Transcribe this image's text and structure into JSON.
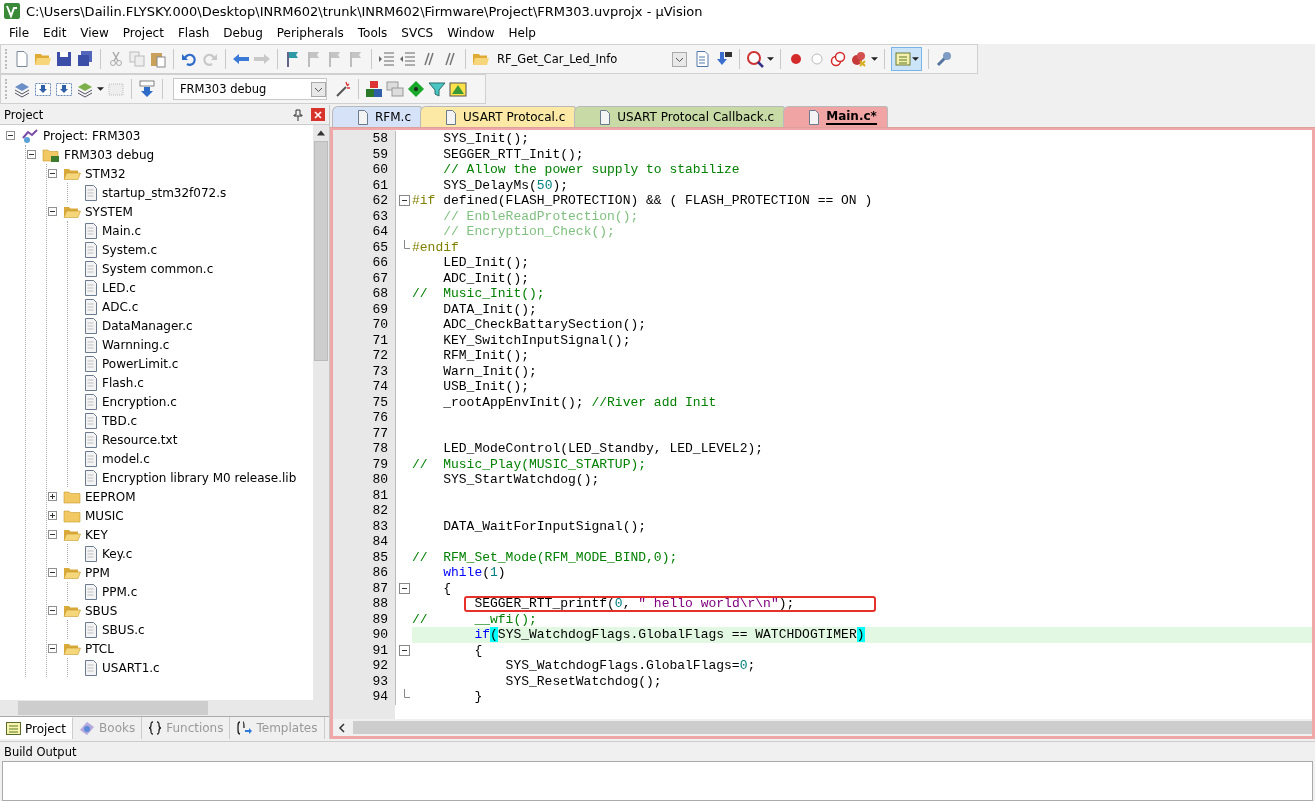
{
  "window": {
    "title": "C:\\Users\\Dailin.FLYSKY.000\\Desktop\\INRM602\\trunk\\INRM602\\Firmware\\Project\\FRM303.uvprojx - µVision"
  },
  "menu": [
    "File",
    "Edit",
    "View",
    "Project",
    "Flash",
    "Debug",
    "Peripherals",
    "Tools",
    "SVCS",
    "Window",
    "Help"
  ],
  "toolbar": {
    "find_combo": "RF_Get_Car_Led_Info",
    "target_combo": "FRM303 debug"
  },
  "project_panel": {
    "title": "Project",
    "tree": [
      {
        "label": "Project: FRM303",
        "kind": "project",
        "expanded": true,
        "children": [
          {
            "label": "FRM303 debug",
            "kind": "target",
            "expanded": true,
            "children": [
              {
                "label": "STM32",
                "kind": "folder",
                "expanded": true,
                "children": [
                  {
                    "label": "startup_stm32f072.s",
                    "kind": "file"
                  }
                ]
              },
              {
                "label": "SYSTEM",
                "kind": "folder",
                "expanded": true,
                "children": [
                  {
                    "label": "Main.c",
                    "kind": "file"
                  },
                  {
                    "label": "System.c",
                    "kind": "file"
                  },
                  {
                    "label": "System common.c",
                    "kind": "file"
                  },
                  {
                    "label": "LED.c",
                    "kind": "file"
                  },
                  {
                    "label": "ADC.c",
                    "kind": "file"
                  },
                  {
                    "label": "DataManager.c",
                    "kind": "file"
                  },
                  {
                    "label": "Warnning.c",
                    "kind": "file"
                  },
                  {
                    "label": "PowerLimit.c",
                    "kind": "file"
                  },
                  {
                    "label": "Flash.c",
                    "kind": "file"
                  },
                  {
                    "label": "Encryption.c",
                    "kind": "file"
                  },
                  {
                    "label": "TBD.c",
                    "kind": "file"
                  },
                  {
                    "label": "Resource.txt",
                    "kind": "file"
                  },
                  {
                    "label": "model.c",
                    "kind": "file"
                  },
                  {
                    "label": "Encryption library M0 release.lib",
                    "kind": "file"
                  }
                ]
              },
              {
                "label": "EEPROM",
                "kind": "folder",
                "expanded": false
              },
              {
                "label": "MUSIC",
                "kind": "folder",
                "expanded": false
              },
              {
                "label": "KEY",
                "kind": "folder",
                "expanded": true,
                "children": [
                  {
                    "label": "Key.c",
                    "kind": "file"
                  }
                ]
              },
              {
                "label": "PPM",
                "kind": "folder",
                "expanded": true,
                "children": [
                  {
                    "label": "PPM.c",
                    "kind": "file"
                  }
                ]
              },
              {
                "label": "SBUS",
                "kind": "folder",
                "expanded": true,
                "children": [
                  {
                    "label": "SBUS.c",
                    "kind": "file"
                  }
                ]
              },
              {
                "label": "PTCL",
                "kind": "folder",
                "expanded": true,
                "children": [
                  {
                    "label": "USART1.c",
                    "kind": "file"
                  }
                ]
              }
            ]
          }
        ]
      }
    ]
  },
  "panel_tabs": [
    {
      "label": "Project",
      "kind": "project",
      "selected": true
    },
    {
      "label": "Books",
      "kind": "books",
      "selected": false
    },
    {
      "label": "Functions",
      "kind": "functions",
      "selected": false
    },
    {
      "label": "Templates",
      "kind": "templates",
      "selected": false
    }
  ],
  "editor": {
    "tabs": [
      {
        "label": "RFM.c",
        "color": "#d6e2f7",
        "selected": false
      },
      {
        "label": "USART Protocal.c",
        "color": "#fbe9a5",
        "selected": false
      },
      {
        "label": "USART Protocal Callback.c",
        "color": "#c8daa6",
        "selected": false
      },
      {
        "label": "Main.c*",
        "color": "#f0a4a4",
        "selected": true
      }
    ],
    "lines": [
      {
        "number": "58",
        "kind": "plain",
        "highlighted": false,
        "outlined": false,
        "segments": [
          {
            "kind": "code",
            "text": "    SYS_Init();"
          }
        ]
      },
      {
        "number": "59",
        "kind": "plain",
        "highlighted": false,
        "outlined": false,
        "segments": [
          {
            "kind": "code",
            "text": "    SEGGER_RTT_Init();"
          }
        ]
      },
      {
        "number": "60",
        "kind": "plain",
        "highlighted": false,
        "outlined": false,
        "segments": [
          {
            "kind": "comment",
            "text": "    // Allow the power supply to stabilize"
          }
        ]
      },
      {
        "number": "61",
        "kind": "plain",
        "highlighted": false,
        "outlined": false,
        "segments": [
          {
            "kind": "code",
            "text": "    SYS_DelayMs("
          },
          {
            "kind": "number",
            "text": "50"
          },
          {
            "kind": "code",
            "text": ");"
          }
        ]
      },
      {
        "number": "62",
        "kind": "fold_start",
        "highlighted": false,
        "outlined": false,
        "segments": [
          {
            "kind": "preproc",
            "text": "#if"
          },
          {
            "kind": "code",
            "text": " defined(FLASH_PROTECTION) && ( FLASH_PROTECTION == ON )"
          }
        ]
      },
      {
        "number": "63",
        "kind": "plain",
        "highlighted": false,
        "outlined": false,
        "segments": [
          {
            "kind": "inactive",
            "text": "    // EnbleReadProtection();"
          }
        ]
      },
      {
        "number": "64",
        "kind": "plain",
        "highlighted": false,
        "outlined": false,
        "segments": [
          {
            "kind": "inactive",
            "text": "    // Encryption_Check();"
          }
        ]
      },
      {
        "number": "65",
        "kind": "fold_end",
        "highlighted": false,
        "outlined": false,
        "segments": [
          {
            "kind": "preproc",
            "text": "#endif"
          }
        ]
      },
      {
        "number": "66",
        "kind": "plain",
        "highlighted": false,
        "outlined": false,
        "segments": [
          {
            "kind": "code",
            "text": "    LED_Init();"
          }
        ]
      },
      {
        "number": "67",
        "kind": "plain",
        "highlighted": false,
        "outlined": false,
        "segments": [
          {
            "kind": "code",
            "text": "    ADC_Init();"
          }
        ]
      },
      {
        "number": "68",
        "kind": "plain",
        "highlighted": false,
        "outlined": false,
        "segments": [
          {
            "kind": "comment",
            "text": "//  Music_Init();"
          }
        ]
      },
      {
        "number": "69",
        "kind": "plain",
        "highlighted": false,
        "outlined": false,
        "segments": [
          {
            "kind": "code",
            "text": "    DATA_Init();"
          }
        ]
      },
      {
        "number": "70",
        "kind": "plain",
        "highlighted": false,
        "outlined": false,
        "segments": [
          {
            "kind": "code",
            "text": "    ADC_CheckBattarySection();"
          }
        ]
      },
      {
        "number": "71",
        "kind": "plain",
        "highlighted": false,
        "outlined": false,
        "segments": [
          {
            "kind": "code",
            "text": "    KEY_SwitchInputSignal();"
          }
        ]
      },
      {
        "number": "72",
        "kind": "plain",
        "highlighted": false,
        "outlined": false,
        "segments": [
          {
            "kind": "code",
            "text": "    RFM_Init();"
          }
        ]
      },
      {
        "number": "73",
        "kind": "plain",
        "highlighted": false,
        "outlined": false,
        "segments": [
          {
            "kind": "code",
            "text": "    Warn_Init();"
          }
        ]
      },
      {
        "number": "74",
        "kind": "plain",
        "highlighted": false,
        "outlined": false,
        "segments": [
          {
            "kind": "code",
            "text": "    USB_Init();"
          }
        ]
      },
      {
        "number": "75",
        "kind": "plain",
        "highlighted": false,
        "outlined": false,
        "segments": [
          {
            "kind": "code",
            "text": "    _rootAppEnvInit(); "
          },
          {
            "kind": "comment",
            "text": "//River add Init"
          }
        ]
      },
      {
        "number": "76",
        "kind": "plain",
        "highlighted": false,
        "outlined": false
      },
      {
        "number": "77",
        "kind": "plain",
        "highlighted": false,
        "outlined": false
      },
      {
        "number": "78",
        "kind": "plain",
        "highlighted": false,
        "outlined": false,
        "segments": [
          {
            "kind": "code",
            "text": "    LED_ModeControl(LED_Standby, LED_LEVEL2);"
          }
        ]
      },
      {
        "number": "79",
        "kind": "plain",
        "highlighted": false,
        "outlined": false,
        "segments": [
          {
            "kind": "comment",
            "text": "//  Music_Play(MUSIC_STARTUP);"
          }
        ]
      },
      {
        "number": "80",
        "kind": "plain",
        "highlighted": false,
        "outlined": false,
        "segments": [
          {
            "kind": "code",
            "text": "    SYS_StartWatchdog();"
          }
        ]
      },
      {
        "number": "81",
        "kind": "plain",
        "highlighted": false,
        "outlined": false
      },
      {
        "number": "82",
        "kind": "plain",
        "highlighted": false,
        "outlined": false
      },
      {
        "number": "83",
        "kind": "plain",
        "highlighted": false,
        "outlined": false,
        "segments": [
          {
            "kind": "code",
            "text": "    DATA_WaitForInputSignal();"
          }
        ]
      },
      {
        "number": "84",
        "kind": "plain",
        "highlighted": false,
        "outlined": false
      },
      {
        "number": "85",
        "kind": "plain",
        "highlighted": false,
        "outlined": false,
        "segments": [
          {
            "kind": "comment",
            "text": "//  RFM_Set_Mode(RFM_MODE_BIND,0);"
          }
        ]
      },
      {
        "number": "86",
        "kind": "plain",
        "highlighted": false,
        "outlined": false,
        "segments": [
          {
            "kind": "keyword",
            "text": "    while"
          },
          {
            "kind": "code",
            "text": "("
          },
          {
            "kind": "number",
            "text": "1"
          },
          {
            "kind": "code",
            "text": ")"
          }
        ]
      },
      {
        "number": "87",
        "kind": "fold_start",
        "highlighted": false,
        "outlined": false,
        "segments": [
          {
            "kind": "code",
            "text": "    {"
          }
        ]
      },
      {
        "number": "88",
        "kind": "plain",
        "highlighted": false,
        "outlined": true,
        "segments": [
          {
            "kind": "code",
            "text": "        SEGGER_RTT_printf("
          },
          {
            "kind": "number",
            "text": "0"
          },
          {
            "kind": "code",
            "text": ", "
          },
          {
            "kind": "string",
            "text": "\" hello world\\r\\n\""
          },
          {
            "kind": "code",
            "text": ");"
          }
        ]
      },
      {
        "number": "89",
        "kind": "plain",
        "highlighted": false,
        "outlined": false,
        "segments": [
          {
            "kind": "comment",
            "text": "//      __wfi();"
          }
        ]
      },
      {
        "number": "90",
        "kind": "plain",
        "highlighted": true,
        "outlined": false,
        "segments": [
          {
            "kind": "keyword",
            "text": "        if"
          },
          {
            "kind": "match",
            "text": "("
          },
          {
            "kind": "code",
            "text": "SYS_WatchdogFlags.GlobalFlags == WATCHDOGTIMER"
          },
          {
            "kind": "match",
            "text": ")"
          }
        ]
      },
      {
        "number": "91",
        "kind": "fold_start",
        "highlighted": false,
        "outlined": false,
        "segments": [
          {
            "kind": "code",
            "text": "        {"
          }
        ]
      },
      {
        "number": "92",
        "kind": "plain",
        "highlighted": false,
        "outlined": false,
        "segments": [
          {
            "kind": "code",
            "text": "            SYS_WatchdogFlags.GlobalFlags="
          },
          {
            "kind": "number",
            "text": "0"
          },
          {
            "kind": "code",
            "text": ";"
          }
        ]
      },
      {
        "number": "93",
        "kind": "plain",
        "highlighted": false,
        "outlined": false,
        "segments": [
          {
            "kind": "code",
            "text": "            SYS_ResetWatchdog();"
          }
        ]
      },
      {
        "number": "94",
        "kind": "fold_end",
        "highlighted": false,
        "outlined": false,
        "segments": [
          {
            "kind": "code",
            "text": "        }"
          }
        ]
      }
    ]
  },
  "build_output": {
    "title": "Build Output"
  }
}
